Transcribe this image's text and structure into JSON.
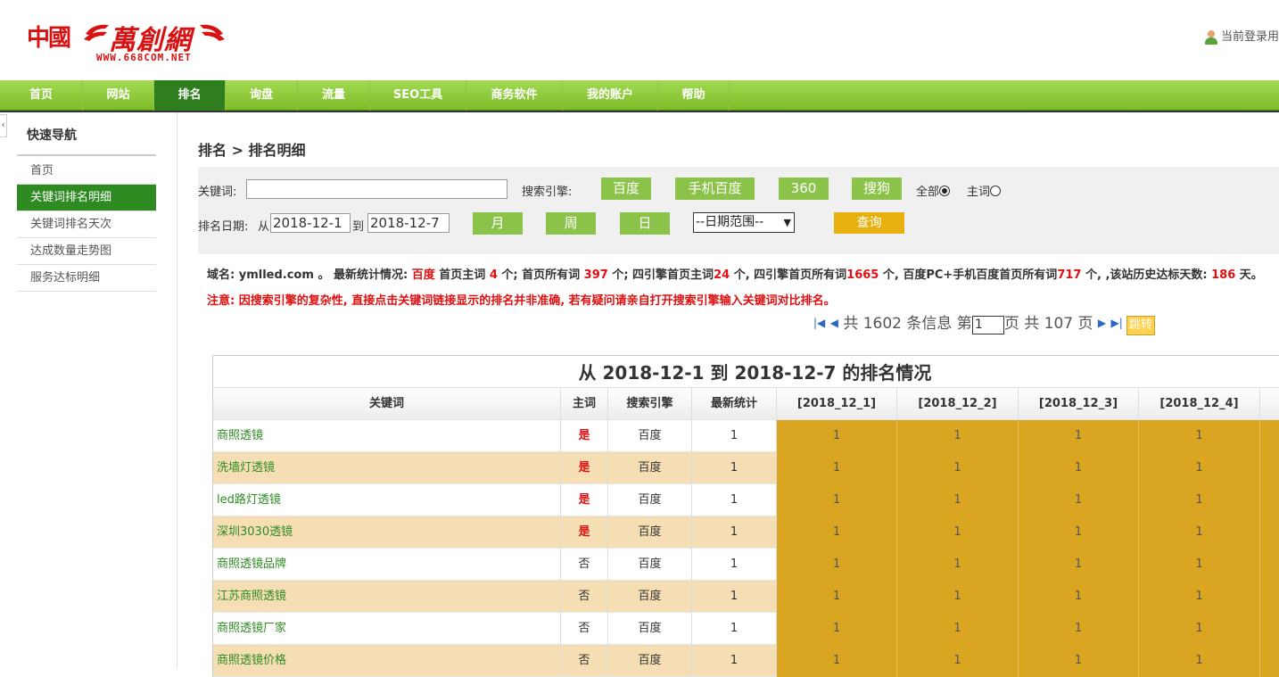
{
  "header": {
    "logo_zg": "中國",
    "logo_brand": "萬創網",
    "logo_url": "WWW.668COM.NET",
    "user_text": "当前登录用"
  },
  "nav": {
    "items": [
      "首页",
      "网站",
      "排名",
      "询盘",
      "流量",
      "SEO工具",
      "商务软件",
      "我的账户",
      "帮助"
    ],
    "active_index": 2
  },
  "sidebar": {
    "title": "快速导航",
    "items": [
      "首页",
      "关键词排名明细",
      "关键词排名天次",
      "达成数量走势图",
      "服务达标明细"
    ],
    "active_index": 1
  },
  "breadcrumb": "排名 > 排名明细",
  "filter": {
    "keyword_label": "关键词:",
    "keyword_value": "",
    "engine_label": "搜索引擎:",
    "engines": [
      "百度",
      "手机百度",
      "360",
      "搜狗"
    ],
    "radio_all": "全部",
    "radio_main": "主词",
    "date_label": "排名日期:",
    "from_label": "从",
    "from_value": "2018-12-1",
    "to_label": "到",
    "to_value": "2018-12-7",
    "period_buttons": [
      "月",
      "周",
      "日"
    ],
    "date_range_select": "--日期范围--",
    "query_button": "查询"
  },
  "stats": {
    "domain_label": "域名:",
    "domain": "ymlled.com",
    "intro": "。 最新统计情况:",
    "engine": "百度",
    "t1": "首页主词",
    "home_main": "4",
    "t2": "个; 首页所有词",
    "home_all": "397",
    "t3": "个; 四引擎首页主词",
    "four_main": "24",
    "t4": "个, 四引擎首页所有词",
    "four_all": "1665",
    "t5": "个, 百度PC+手机百度首页所有词",
    "pc_mobile": "717",
    "t6": "个, ,该站历史达标天数:",
    "days": "186",
    "t7": "天。"
  },
  "notice": "注意: 因搜索引擎的复杂性, 直接点击关键词链接显示的排名并非准确, 若有疑问请亲自打开搜索引擎输入关键词对比排名。",
  "pager": {
    "t1": "共",
    "total": "1602",
    "t2": "条信息 第",
    "page": "1",
    "t3": "页 共",
    "pages": "107",
    "t4": "页",
    "jump": "跳转"
  },
  "table": {
    "caption": "从 2018-12-1 到 2018-12-7 的排名情况",
    "headers": [
      "关键词",
      "主词",
      "搜索引擎",
      "最新统计",
      "[2018_12_1]",
      "[2018_12_2]",
      "[2018_12_3]",
      "[2018_12_4]",
      ""
    ],
    "rows": [
      {
        "keyword": "商照透镜",
        "main": "是",
        "engine": "百度",
        "latest": "1",
        "d1": "1",
        "d2": "1",
        "d3": "1",
        "d4": "1"
      },
      {
        "keyword": "洗墙灯透镜",
        "main": "是",
        "engine": "百度",
        "latest": "1",
        "d1": "1",
        "d2": "1",
        "d3": "1",
        "d4": "1"
      },
      {
        "keyword": "led路灯透镜",
        "main": "是",
        "engine": "百度",
        "latest": "1",
        "d1": "1",
        "d2": "1",
        "d3": "1",
        "d4": "1"
      },
      {
        "keyword": "深圳3030透镜",
        "main": "是",
        "engine": "百度",
        "latest": "1",
        "d1": "1",
        "d2": "1",
        "d3": "1",
        "d4": "1"
      },
      {
        "keyword": "商照透镜品牌",
        "main": "否",
        "engine": "百度",
        "latest": "1",
        "d1": "1",
        "d2": "1",
        "d3": "1",
        "d4": "1"
      },
      {
        "keyword": "江苏商照透镜",
        "main": "否",
        "engine": "百度",
        "latest": "1",
        "d1": "1",
        "d2": "1",
        "d3": "1",
        "d4": "1"
      },
      {
        "keyword": "商照透镜厂家",
        "main": "否",
        "engine": "百度",
        "latest": "1",
        "d1": "1",
        "d2": "1",
        "d3": "1",
        "d4": "1"
      },
      {
        "keyword": "商照透镜价格",
        "main": "否",
        "engine": "百度",
        "latest": "1",
        "d1": "1",
        "d2": "1",
        "d3": "1",
        "d4": "1"
      }
    ]
  },
  "colors": {
    "nav_green": "#8bc34a",
    "active_green": "#2e8b22",
    "rank_gold": "#daa520",
    "alt_row": "#f5deb3",
    "alert_red": "#e01010",
    "query_gold": "#e5b010"
  }
}
